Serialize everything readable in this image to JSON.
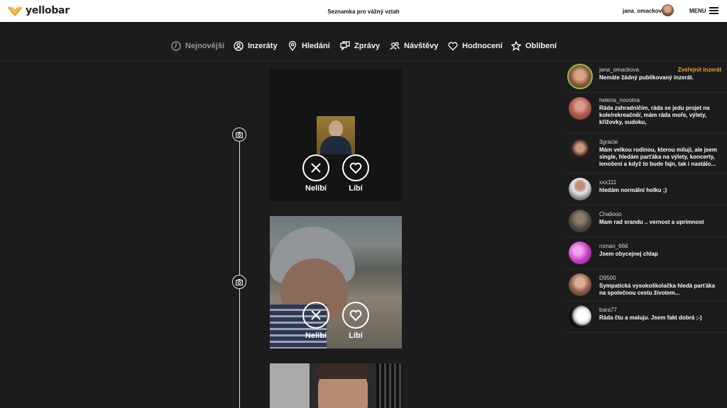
{
  "topbar": {
    "logo_text": "yellobar",
    "tagline": "Seznamka pro vážný vztah",
    "username": "jana_omackova",
    "menu_label": "MENU",
    "brand_color": "#f4a51c"
  },
  "nav": {
    "items": [
      {
        "label": "Nejnovější",
        "icon": "clock-icon",
        "active": true
      },
      {
        "label": "Inzeráty",
        "icon": "user-circle-icon"
      },
      {
        "label": "Hledání",
        "icon": "map-pin-icon"
      },
      {
        "label": "Zprávy",
        "icon": "chat-icon"
      },
      {
        "label": "Návštěvy",
        "icon": "users-icon"
      },
      {
        "label": "Hodnocení",
        "icon": "heart-icon"
      },
      {
        "label": "Oblíbení",
        "icon": "star-icon"
      }
    ]
  },
  "timeline": {
    "cards": [
      {
        "dislike_label": "Nelíbí",
        "like_label": "Líbí",
        "marker_icon": "photo-icon"
      },
      {
        "dislike_label": "Nelíbí",
        "like_label": "Líbí",
        "marker_icon": "photo-icon"
      }
    ]
  },
  "sidebar": {
    "publish_link": "Zveřejnit inzerát",
    "items": [
      {
        "username": "jana_omackova",
        "text": "Nemáte žádný publikovaný inzerát."
      },
      {
        "username": "helena_novotna",
        "text": "Ráda zahradničím, ráda se jedu projet na kole/rekreačně/, mám ráda moře, výlety, křížovky, sudoku,"
      },
      {
        "username": "3gracie",
        "text": "Mám velkou rodinou, kterou miluji, ale jsem single, hledám parťáka na výlety, koncerty, lenošení a když to bude fajn, tak i nastálo..."
      },
      {
        "username": "xxx111",
        "text": "hledám normální holku ;)"
      },
      {
        "username": "Chaliooo",
        "text": "Mam rad srandu .. vernost a uprimnost"
      },
      {
        "username": "roman_666",
        "text": "Jsem obycejnej chlap"
      },
      {
        "username": "D9500",
        "text": "Sympatická vysokoškolačka hledá parťáka na společnou cestu životem..."
      },
      {
        "username": "bara77",
        "text": "Ráda čtu a maluju. Jsem fakt dobrá ;-)"
      }
    ]
  }
}
